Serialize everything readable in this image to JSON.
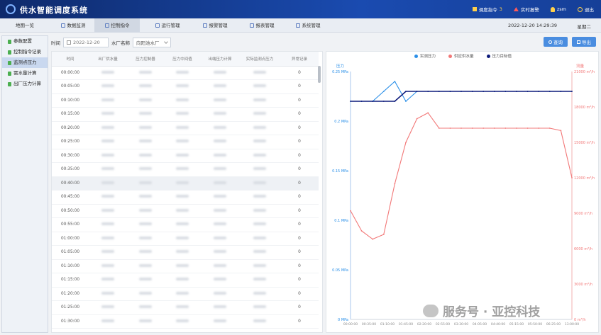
{
  "app": {
    "title": "供水智能调度系统"
  },
  "topbar": {
    "dispatch_label": "调度指令",
    "dispatch_count": "3",
    "alarm_label": "实时报警",
    "user": "zsm",
    "logout": "退出"
  },
  "nav": {
    "tabs": [
      "地图一览",
      "数据监测",
      "控制指令",
      "运行管理",
      "报警管理",
      "报表管理",
      "系统管理"
    ],
    "active": "控制指令",
    "datetime": "2022-12-20 14:29:39",
    "weekday": "星期二"
  },
  "sidebar": {
    "items": [
      "参数配置",
      "控制指令记录",
      "监测点压力",
      "需水量计算",
      "出厂压力计算"
    ],
    "active": "监测点压力"
  },
  "filters": {
    "time_label": "时间",
    "date_value": "2022-12-20",
    "plant_label": "水厂名称",
    "plant_value": "向阳池水厂",
    "search_btn": "查询",
    "export_btn": "导出"
  },
  "table": {
    "headers": [
      "时间",
      "出厂供水量",
      "压力控制器",
      "压力中间值",
      "出端压力计算",
      "实际监测点压力",
      "异常记录"
    ],
    "rows": [
      {
        "time": "00:00:00",
        "count": "0"
      },
      {
        "time": "00:05:00",
        "count": "0"
      },
      {
        "time": "00:10:00",
        "count": "0"
      },
      {
        "time": "00:15:00",
        "count": "0"
      },
      {
        "time": "00:20:00",
        "count": "0"
      },
      {
        "time": "00:25:00",
        "count": "0"
      },
      {
        "time": "00:30:00",
        "count": "0"
      },
      {
        "time": "00:35:00",
        "count": "0"
      },
      {
        "time": "00:40:00",
        "count": "0"
      },
      {
        "time": "00:45:00",
        "count": "0"
      },
      {
        "time": "00:50:00",
        "count": "0"
      },
      {
        "time": "00:55:00",
        "count": "0"
      },
      {
        "time": "01:00:00",
        "count": "0"
      },
      {
        "time": "01:05:00",
        "count": "0"
      },
      {
        "time": "01:10:00",
        "count": "0"
      },
      {
        "time": "01:15:00",
        "count": "0"
      },
      {
        "time": "01:20:00",
        "count": "0"
      },
      {
        "time": "01:25:00",
        "count": "0"
      },
      {
        "time": "01:30:00",
        "count": "0"
      }
    ],
    "highlighted_row": 8
  },
  "colors": {
    "actual_pressure": "#2a8fe8",
    "supply": "#f27878",
    "recommended": "#0c1a7a"
  },
  "chart_data": {
    "type": "line",
    "legend": [
      "实测压力",
      "供应供水量",
      "压力目标值"
    ],
    "legend_position": "top",
    "yleft_label": "压力",
    "yright_label": "流量",
    "yleft_ticks": [
      "0 MPa",
      "0.05 MPa",
      "0.1 MPa",
      "0.15 MPa",
      "0.2 MPa",
      "0.25 MPa"
    ],
    "yright_ticks": [
      "0 m³/h",
      "3000 m³/h",
      "6000 m³/h",
      "9000 m³/h",
      "12000 m³/h",
      "15000 m³/h",
      "18000 m³/h",
      "21000 m³/h"
    ],
    "yleft_lim": [
      0,
      0.25
    ],
    "yright_lim": [
      0,
      21000
    ],
    "x_ticks": [
      "00:00:00",
      "00:35:00",
      "01:10:00",
      "01:45:00",
      "02:20:00",
      "02:55:00",
      "03:30:00",
      "04:05:00",
      "04:40:00",
      "05:15:00",
      "05:50:00",
      "06:25:00",
      "13:00:00"
    ],
    "x": [
      0,
      5,
      10,
      15,
      20,
      25,
      30,
      35,
      40,
      45,
      50,
      55,
      60,
      65,
      70,
      75,
      80,
      85,
      90,
      95,
      100
    ],
    "series": [
      {
        "name": "实测压力",
        "axis": "left",
        "values": [
          0.22,
          0.22,
          0.22,
          0.23,
          0.24,
          0.22,
          0.23,
          0.23,
          0.23,
          0.23,
          0.23,
          0.23,
          0.23,
          0.23,
          0.23,
          0.23,
          0.23,
          0.23,
          0.23,
          0.23,
          0.23
        ]
      },
      {
        "name": "供应供水量",
        "axis": "right",
        "values": [
          9200,
          7500,
          6800,
          7200,
          11500,
          15000,
          17000,
          17500,
          16200,
          16200,
          16200,
          16200,
          16200,
          16200,
          16200,
          16200,
          16200,
          16200,
          16200,
          16000,
          12000
        ]
      },
      {
        "name": "压力目标值",
        "axis": "left",
        "values": [
          0.22,
          0.22,
          0.22,
          0.22,
          0.22,
          0.23,
          0.23,
          0.23,
          0.23,
          0.23,
          0.23,
          0.23,
          0.23,
          0.23,
          0.23,
          0.23,
          0.23,
          0.23,
          0.23,
          0.23,
          0.23
        ]
      }
    ],
    "grid": false
  },
  "watermark": "服务号 · 亚控科技"
}
